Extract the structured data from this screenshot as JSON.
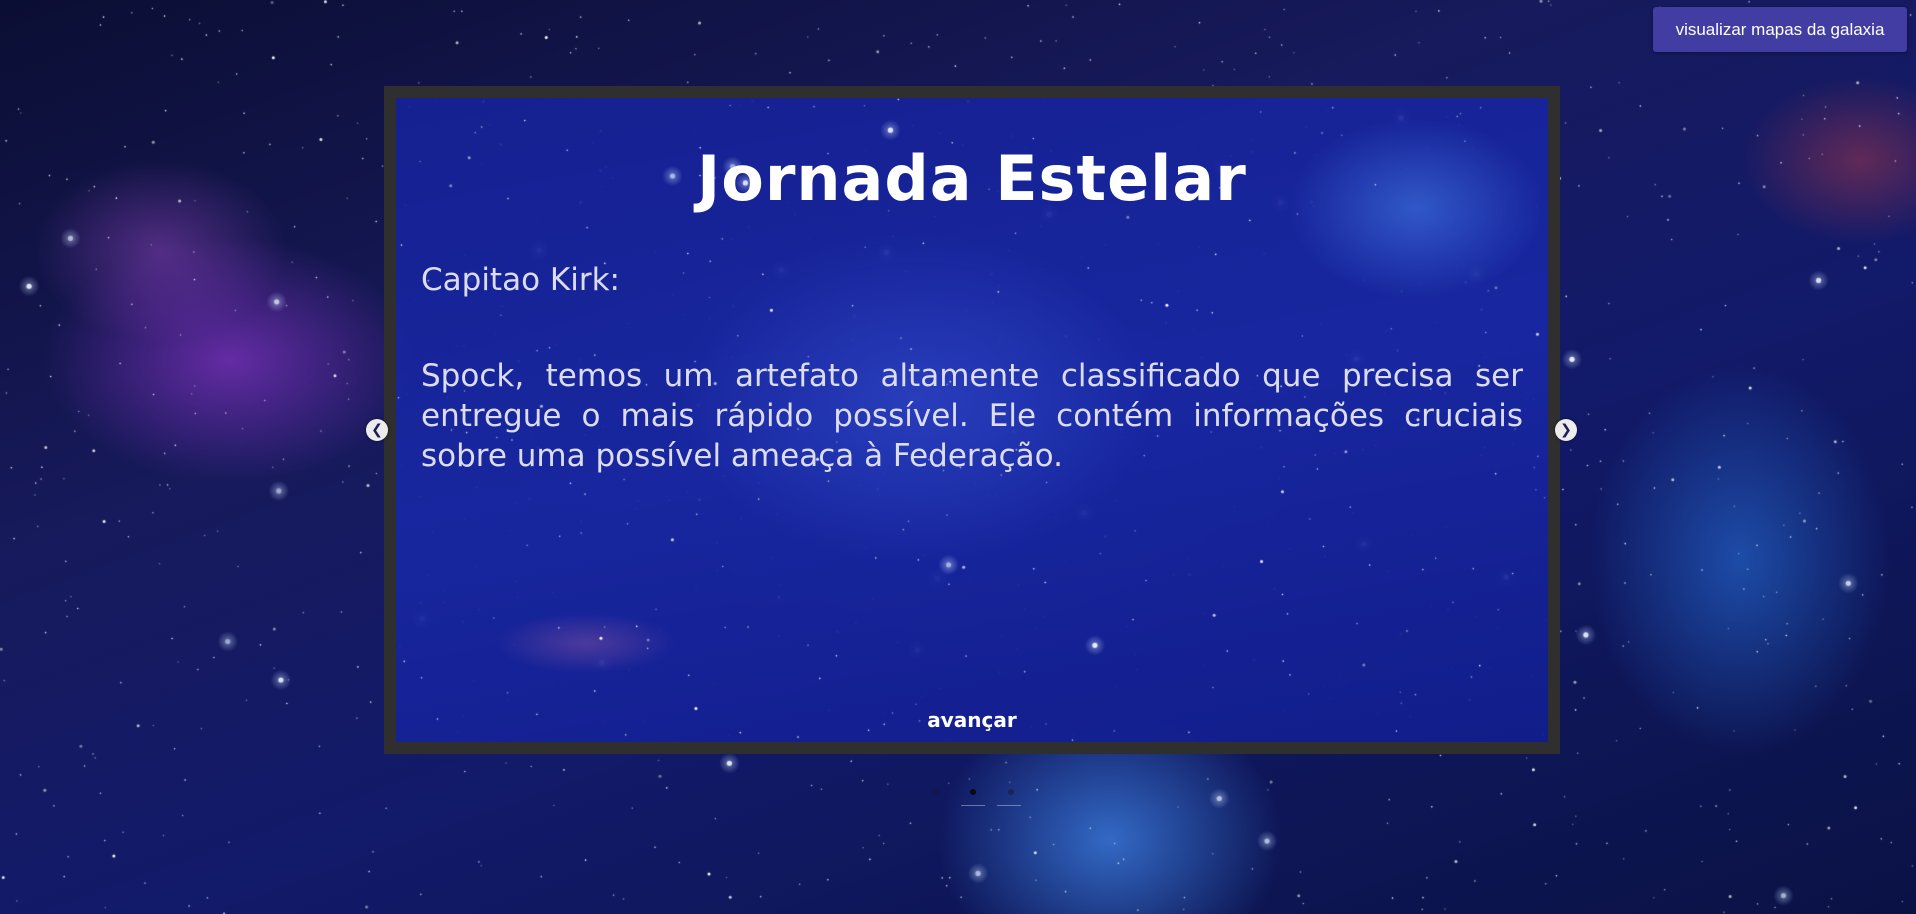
{
  "header": {
    "map_button_label": "visualizar mapas da galaxia"
  },
  "slide": {
    "title": "Jornada Estelar",
    "speaker": "Capitao Kirk:",
    "dialogue": "Spock, temos um artefato altamente classificado que precisa ser entregue o mais rápido possível. Ele contém informações cruciais sobre uma possível ameaça à Federação.",
    "advance_label": "avançar"
  },
  "carousel": {
    "prev_icon": "chevron-left-icon",
    "next_icon": "chevron-right-icon",
    "prev_glyph": "❮",
    "next_glyph": "❯",
    "indicator_count": 3,
    "active_indicator": 2
  },
  "colors": {
    "button_bg": "#413da3",
    "frame_border": "#2f2f2f",
    "slide_text": "#dcdcf0",
    "title_text": "#ffffff"
  }
}
